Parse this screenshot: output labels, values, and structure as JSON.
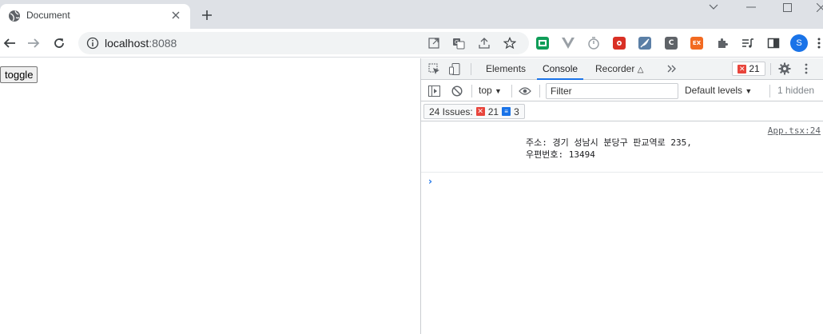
{
  "browser": {
    "tab_title": "Document",
    "url_host": "localhost",
    "url_port": ":8088",
    "profile_initial": "S"
  },
  "extensions": [
    {
      "icon": "green-screen-extension-icon",
      "color": "#0f9d58"
    },
    {
      "icon": "vue-devtools-extension-icon",
      "color": "#9aa0a6"
    },
    {
      "icon": "timer-extension-icon",
      "color": "#9aa0a6"
    },
    {
      "icon": "red-puzzle-extension-icon",
      "color": "#d93025"
    },
    {
      "icon": "blue-feather-extension-icon",
      "color": "#5b7fa6"
    },
    {
      "icon": "c-extension-icon",
      "label": "C",
      "color": "#5f6368"
    },
    {
      "icon": "ex-extension-icon",
      "label": "EX",
      "color": "#f26a21"
    }
  ],
  "page": {
    "toggle_label": "toggle"
  },
  "devtools": {
    "tabs": [
      "Elements",
      "Console",
      "Recorder"
    ],
    "active_tab": "Console",
    "error_count": "21",
    "context": "top",
    "filter_placeholder": "Filter",
    "levels": "Default levels",
    "hidden": "1 hidden",
    "issues_label": "24 Issues:",
    "issues_errors": "21",
    "issues_info": "3",
    "log": {
      "source": "App.tsx:24",
      "line1": "주소: 경기 성남시 분당구 판교역로 235,",
      "line2": "우편번호: 13494"
    },
    "prompt": "›"
  },
  "colors": {
    "accent": "#1a73e8",
    "error": "#e8453c"
  }
}
